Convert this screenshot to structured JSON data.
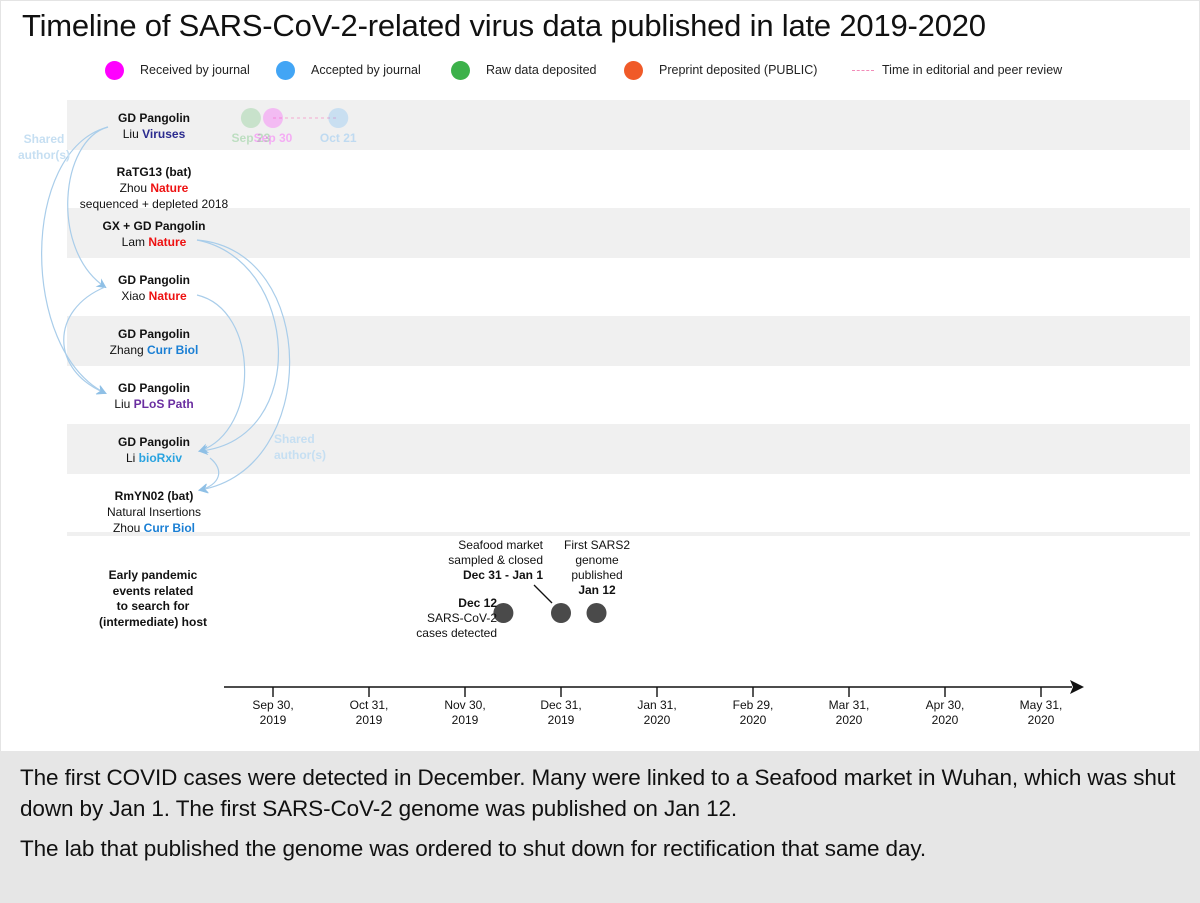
{
  "title": "Timeline of SARS-CoV-2-related virus data published in late 2019-2020",
  "legend": [
    {
      "label": "Received by journal",
      "color": "#ff00ff",
      "kind": "dot"
    },
    {
      "label": "Accepted by journal",
      "color": "#42a5f5",
      "kind": "dot"
    },
    {
      "label": "Raw data deposited",
      "color": "#3cb14a",
      "kind": "dot"
    },
    {
      "label": "Preprint deposited (PUBLIC)",
      "color": "#f05a28",
      "kind": "dot"
    },
    {
      "label": "Time in editorial and peer review",
      "color": "#f28bb8",
      "kind": "dash"
    }
  ],
  "rows": [
    {
      "name": "GD Pangolin",
      "author": "Liu",
      "journal": "Viruses",
      "journal_color": "#2b2b8f",
      "extra": ""
    },
    {
      "name": "RaTG13 (bat)",
      "author": "Zhou",
      "journal": "Nature",
      "journal_color": "#ee1111",
      "extra": "sequenced + depleted 2018"
    },
    {
      "name": "GX + GD Pangolin",
      "author": "Lam",
      "journal": "Nature",
      "journal_color": "#ee1111",
      "extra": ""
    },
    {
      "name": "GD Pangolin",
      "author": "Xiao",
      "journal": "Nature",
      "journal_color": "#ee1111",
      "extra": ""
    },
    {
      "name": "GD Pangolin",
      "author": "Zhang",
      "journal": "Curr Biol",
      "journal_color": "#1a7fd4",
      "extra": ""
    },
    {
      "name": "GD Pangolin",
      "author": "Liu",
      "journal": "PLoS Path",
      "journal_color": "#6a2ea0",
      "extra": ""
    },
    {
      "name": "GD Pangolin",
      "author": "Li",
      "journal": "bioRxiv",
      "journal_color": "#29a3e0",
      "extra": ""
    },
    {
      "name": "RmYN02 (bat)",
      "author": "Zhou",
      "journal": "Curr Biol",
      "journal_color": "#1a7fd4",
      "extra": "Natural Insertions"
    }
  ],
  "shared_authors_label": [
    "Shared",
    "author(s)"
  ],
  "early_events_label": [
    "Early pandemic",
    "events related",
    "to search for",
    "(intermediate) host"
  ],
  "events": [
    {
      "date_label": "Dec 12",
      "desc": [
        "SARS-CoV-2",
        "cases detected"
      ]
    },
    {
      "date_label": "Dec 31 - Jan 1",
      "desc": [
        "Seafood market",
        "sampled & closed"
      ]
    },
    {
      "date_label": "Jan 12",
      "desc": [
        "First SARS2",
        "genome",
        "published"
      ]
    }
  ],
  "caption": [
    "The first COVID cases were detected in December. Many were linked to a Seafood market in Wuhan, which was shut down by Jan 1. The first SARS-CoV-2 genome was published on Jan 12.",
    "The lab that published the genome was ordered to shut down for rectification that same day."
  ],
  "chart_data": {
    "type": "timeline",
    "title": "Timeline of SARS-CoV-2-related virus data published in late 2019-2020",
    "x_axis": {
      "ticks": [
        "Sep 30, 2019",
        "Oct 31, 2019",
        "Nov 30, 2019",
        "Dec 31, 2019",
        "Jan 31, 2020",
        "Feb 29, 2020",
        "Mar 31, 2020",
        "Apr 30, 2020",
        "May 31, 2020"
      ],
      "tick_lines": [
        [
          "Sep 30,",
          "2019"
        ],
        [
          "Oct 31,",
          "2019"
        ],
        [
          "Nov 30,",
          "2019"
        ],
        [
          "Dec 31,",
          "2019"
        ],
        [
          "Jan 31,",
          "2020"
        ],
        [
          "Feb 29,",
          "2020"
        ],
        [
          "Mar 31,",
          "2020"
        ],
        [
          "Apr 30,",
          "2020"
        ],
        [
          "May 31,",
          "2020"
        ]
      ],
      "range_months_from_sep30_2019": [
        -0.5,
        8.4
      ]
    },
    "milestones": [
      {
        "row": 0,
        "type": "Raw data deposited",
        "label": "Sep 23",
        "months": -0.23,
        "color": "#3cb14a",
        "faded": true
      },
      {
        "row": 0,
        "type": "Received by journal",
        "label": "Sep 30",
        "months": 0.0,
        "color": "#ff00ff",
        "faded": true
      },
      {
        "row": 0,
        "type": "Accepted by journal",
        "label": "Oct 21",
        "months": 0.68,
        "color": "#42a5f5",
        "faded": true
      }
    ],
    "review_periods": [
      {
        "row": 0,
        "from_months": 0.0,
        "to_months": 0.68
      }
    ],
    "event_points": [
      {
        "label": "Dec 12",
        "months": 2.4
      },
      {
        "label": "Dec 31 - Jan 1",
        "months": 3.0
      },
      {
        "label": "Jan 12",
        "months": 3.37
      }
    ],
    "shared_author_links": [
      {
        "from_row": 0,
        "to_row": 3
      },
      {
        "from_row": 0,
        "to_row": 5
      },
      {
        "from_row": 3,
        "to_row": 5
      },
      {
        "from_row": 2,
        "to_row": 6
      },
      {
        "from_row": 2,
        "to_row": 7
      },
      {
        "from_row": 3,
        "to_row": 6
      },
      {
        "from_row": 6,
        "to_row": 7
      }
    ]
  }
}
